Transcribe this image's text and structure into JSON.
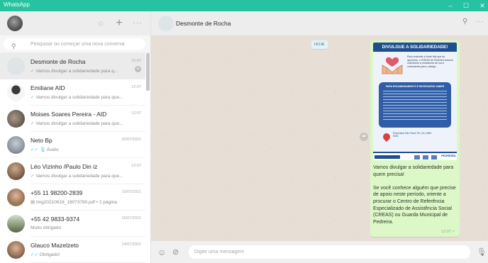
{
  "app": {
    "title": "WhatsApp"
  },
  "window": {
    "minimize": "–",
    "maximize": "☐",
    "close": "✕"
  },
  "sidebar": {
    "search_placeholder": "Pesquisar ou começar uma nova conversa",
    "chats": [
      {
        "name": "Desmonte de Rocha",
        "time": "12:07",
        "preview": "Vamos divulgar a solidariedade para q...",
        "preview_tick": "✓",
        "active": true,
        "muted": true
      },
      {
        "name": "Emiliane AID",
        "time": "12:07",
        "preview": "Vamos divulgar a solidariedade para que...",
        "preview_tick": "✓"
      },
      {
        "name": "Moises Soares Pereira - AID",
        "time": "12:07",
        "preview": "Vamos divulgar a solidariedade para que...",
        "preview_tick": "✓"
      },
      {
        "name": "Neto Bp",
        "time": "20/07/2021",
        "preview": "Áudio",
        "preview_tick": "✓✓"
      },
      {
        "name": "Léo Vizinho /Paulo Din iz",
        "time": "12:07",
        "preview": "Vamos divulgar a solidariedade para que...",
        "preview_tick": "✓"
      },
      {
        "name": "+55 11 98200-2839",
        "time": "15/07/2021",
        "preview": "Img20210616_18073780.pdf • 1 página",
        "preview_tick": ""
      },
      {
        "name": "+55 42 9833-9374",
        "time": "15/07/2021",
        "preview": "Muito obrigado",
        "preview_tick": ""
      },
      {
        "name": "Glauco Mazelzeto",
        "time": "14/07/2021",
        "preview": "Obrigado!",
        "preview_tick": "✓✓"
      }
    ]
  },
  "conversation": {
    "contact_name": "Desmonte de Rocha",
    "date_chip": "HOJE",
    "poster": {
      "title": "DIVULGUE A SOLIDARIEDADE!",
      "text": "Para entender a fonte this que se aproxima, o CREAS de Pedreira fornece cobertores a moradores de rua e vulneráveis para o abrigo.",
      "box_title": "PARA ENCAMINHAMENTO É NECESSÁRIO SABER",
      "pin_text": "Rodoviária São Paulo Tel: (11) 3380-5400",
      "footer_text": "PEDREIRA"
    },
    "message_paragraphs": [
      "Vamos divulgar a solidariedade para quem precisa!",
      "Se você conhece alguém que precise de apoio neste período, oriente a procurar o  Centro de Referência Especializado de Assistência Social (CREAS) ou Guarda Municipal de Pedreira."
    ],
    "message_time": "12:07 ✓",
    "composer_placeholder": "Digite uma mensagem"
  },
  "colors": {
    "brand": "#27c3a0",
    "bubble": "#dcf8c6",
    "read_tick": "#53bdeb"
  },
  "icons": {
    "status": "status-icon",
    "new_chat": "new-chat-icon",
    "menu": "menu-icon",
    "search": "search-icon",
    "emoji": "emoji-icon",
    "attach": "attach-icon",
    "mic": "mic-icon"
  }
}
